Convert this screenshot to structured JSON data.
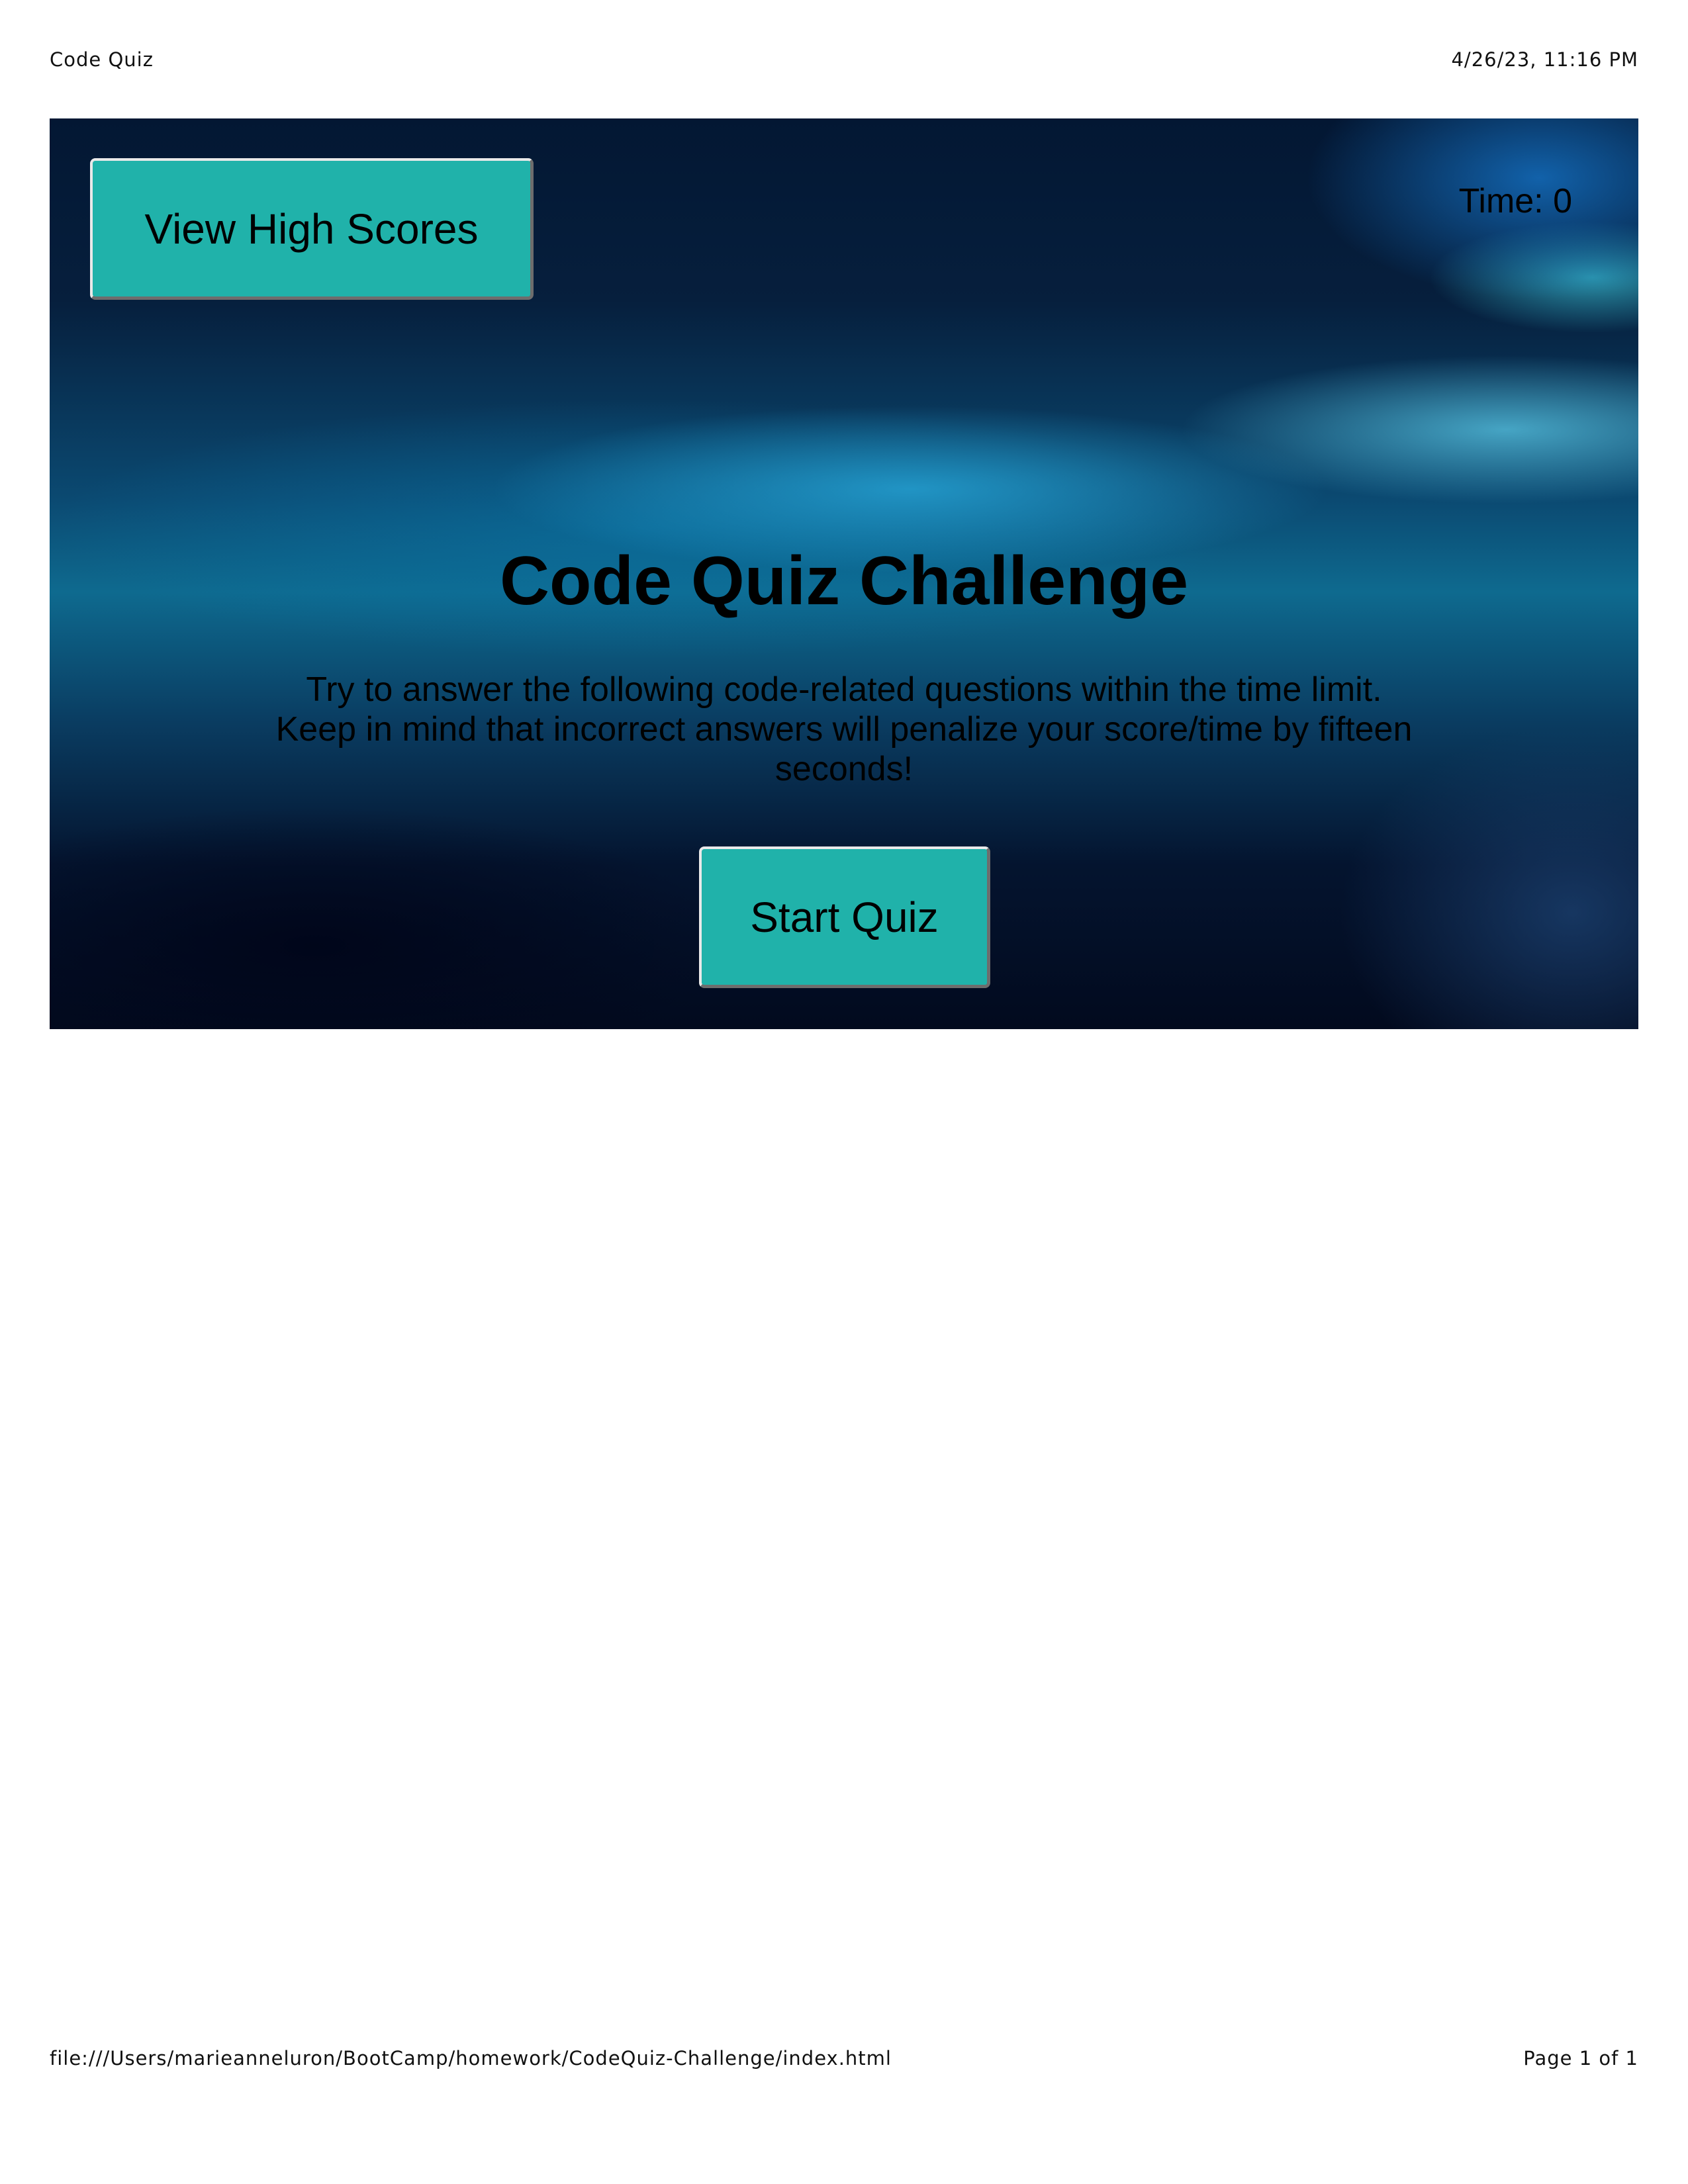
{
  "print": {
    "header_title": "Code Quiz",
    "header_datetime": "4/26/23, 11:16 PM",
    "footer_url": "file:///Users/marieanneluron/BootCamp/homework/CodeQuiz-Challenge/index.html",
    "footer_page": "Page 1 of 1"
  },
  "header": {
    "high_scores_label": "View High Scores",
    "timer_text": "Time: 0"
  },
  "main": {
    "title": "Code Quiz Challenge",
    "intro": "Try to answer the following code-related questions within the time limit. Keep in mind that incorrect answers will penalize your score/time by fifteen seconds!",
    "start_label": "Start Quiz"
  },
  "colors": {
    "button_bg": "#20b2aa",
    "page_bg": "#ffffff",
    "banner_dark": "#031733",
    "banner_accent": "#0e6a8f"
  }
}
